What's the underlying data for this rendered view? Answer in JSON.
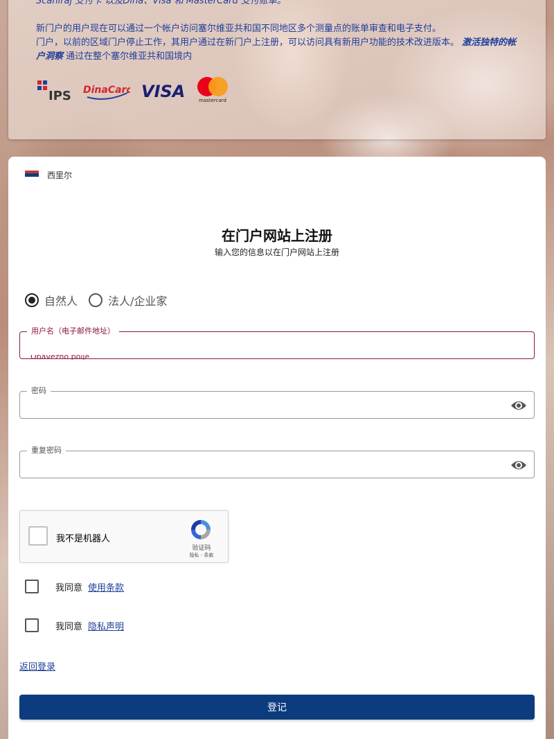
{
  "info": {
    "line1": "Scaniraj 支付卡 以及Dina、Visa 和 MasterCard 支付账单。",
    "para_line1": "新门户的用户现在可以通过一个帐户访问塞尔维亚共和国不同地区多个测量点的账单审查和电子支付。",
    "para_line2": "门户，以前的区域门户停止工作，其用户通过在新门户上注册，可以访问具有新用户功能的技术改进版本。",
    "para_bold": "激活独特的帐户洞察",
    "para_tail": "通过在整个塞尔维亚共和国境内",
    "payment_logos": [
      "IPS",
      "DinaCard",
      "VISA",
      "mastercard"
    ]
  },
  "language": {
    "label": "西里尔"
  },
  "form": {
    "title": "在门户网站上注册",
    "subtitle": "输入您的信息以在门户网站上注册",
    "radio_options": [
      {
        "label": "自然人",
        "checked": true
      },
      {
        "label": "法人/企业家",
        "checked": false
      }
    ],
    "username": {
      "label": "用户名（电子邮件地址）",
      "value": "",
      "error": "Obavezno polje"
    },
    "password": {
      "label": "密码",
      "value": ""
    },
    "repeat_password": {
      "label": "重复密码",
      "value": ""
    },
    "captcha": {
      "label": "我不是机器人",
      "brand": "验证码",
      "links": "隐私 - 条款"
    },
    "terms": {
      "prefix": "我同意",
      "link": "使用条款"
    },
    "privacy": {
      "prefix": "我同意",
      "link": "隐私声明"
    },
    "back_link": "返回登录",
    "submit": "登记"
  },
  "colors": {
    "primary": "#0c3c7e",
    "error": "#8a1738",
    "link": "#1f3f9a"
  }
}
